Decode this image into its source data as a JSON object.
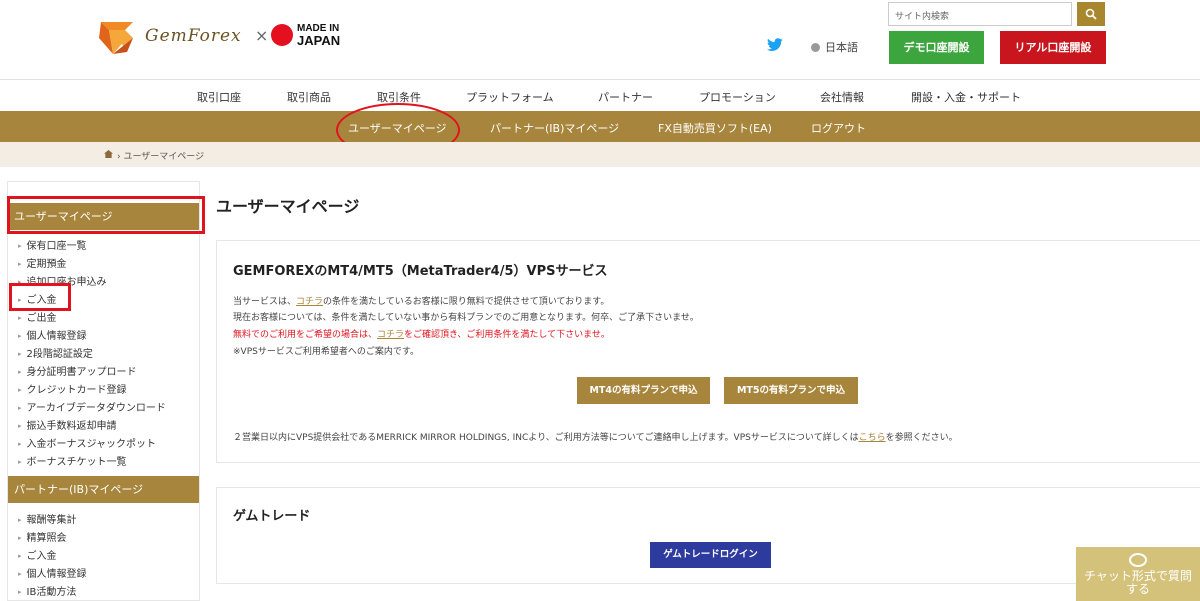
{
  "header": {
    "logo_text": "GemForex",
    "logo_x": "×",
    "made_in_small": "MADE IN",
    "made_in_big": "JAPAN",
    "search_placeholder": "サイト内検索",
    "search_icon": "magnifier-icon",
    "language": "日本語",
    "demo_button": "デモ口座開設",
    "real_button": "リアル口座開設",
    "colors": {
      "green": "#3da53d",
      "red": "#c9161e",
      "gold": "#a8853c"
    }
  },
  "main_nav": [
    "取引口座",
    "取引商品",
    "取引条件",
    "プラットフォーム",
    "パートナー",
    "プロモーション",
    "会社情報",
    "開設・入金・サポート"
  ],
  "sub_nav": [
    "ユーザーマイページ",
    "パートナー(IB)マイページ",
    "FX自動売買ソフト(EA)",
    "ログアウト"
  ],
  "breadcrumb": "› ユーザーマイページ",
  "sidebar": {
    "user_header": "ユーザーマイページ",
    "user_items": [
      "保有口座一覧",
      "定期預金",
      "追加口座お申込み",
      "ご入金",
      "ご出金",
      "個人情報登録",
      "2段階認証設定",
      "身分証明書アップロード",
      "クレジットカード登録",
      "アーカイブデータダウンロード",
      "振込手数料返却申請",
      "入金ボーナスジャックポット",
      "ボーナスチケット一覧"
    ],
    "partner_header": "パートナー(IB)マイページ",
    "partner_items": [
      "報酬等集計",
      "精算照会",
      "ご入金",
      "個人情報登録",
      "IB活動方法"
    ]
  },
  "main": {
    "title": "ユーザーマイページ",
    "vps": {
      "title": "GEMFOREXのMT4/MT5（MetaTrader4/5）VPSサービス",
      "line1_a": "当サービスは、",
      "line1_link": "コチラ",
      "line1_b": "の条件を満たしているお客様に限り無料で提供させて頂いております。",
      "line2": "現在お客様については、条件を満たしていない事から有料プランでのご用意となります。何卒、ご了承下さいませ。",
      "line3_a": "無料でのご利用をご希望の場合は、",
      "line3_link": "コチラ",
      "line3_b": "をご確認頂き、ご利用条件を満たして下さいませ。",
      "line4": "※VPSサービスご利用希望者へのご案内です。",
      "mt4_button": "MT4の有料プランで申込",
      "mt5_button": "MT5の有料プランで申込",
      "footer_a": "２営業日以内にVPS提供会社であるMERRICK MIRROR HOLDINGS, INCより、ご利用方法等についてご連絡申し上げます。VPSサービスについて詳しくは",
      "footer_link": "こちら",
      "footer_b": "を参照ください。"
    },
    "gemtrade": {
      "title": "ゲムトレード",
      "login_button": "ゲムトレードログイン"
    }
  },
  "chat": {
    "line1": "チャット形式で質問",
    "line2": "する",
    "icon": "chat-bubble-icon"
  }
}
